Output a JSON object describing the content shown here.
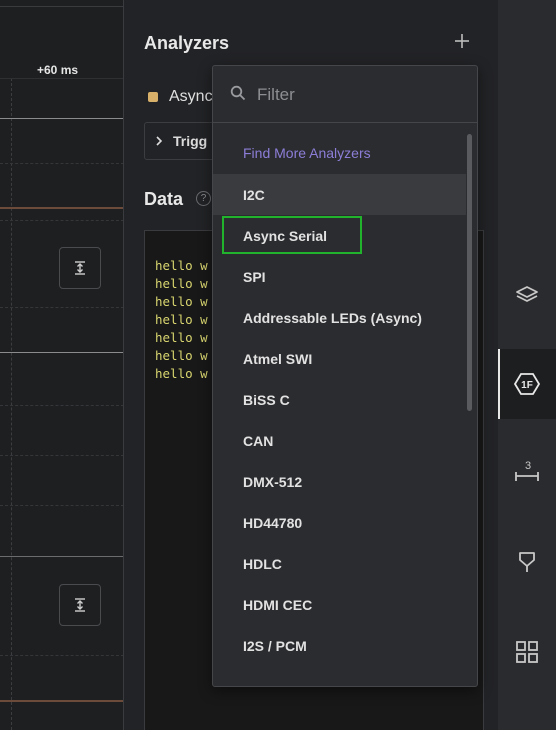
{
  "timeline": {
    "marker": "+60 ms"
  },
  "analyzers_panel": {
    "title": "Analyzers",
    "add_icon": "plus-icon",
    "analyzer_name": "Async",
    "analyzer_color": "#d8b06a",
    "trigger_label": "Trigg",
    "data_title": "Data",
    "help_glyph": "?",
    "terminal_lines": [
      "hello w",
      "hello w",
      "hello w",
      "hello w",
      "hello w",
      "hello w",
      "hello w"
    ]
  },
  "dropdown": {
    "filter_placeholder": "Filter",
    "find_more_label": "Find More Analyzers",
    "options": [
      "I2C",
      "Async Serial",
      "SPI",
      "Addressable LEDs (Async)",
      "Atmel SWI",
      "BiSS C",
      "CAN",
      "DMX-512",
      "HD44780",
      "HDLC",
      "HDMI CEC",
      "I2S / PCM"
    ],
    "hovered_option": "I2C",
    "highlighted_option": "Async Serial",
    "highlight_color": "#22b32c",
    "accent_color": "#8c7ed8"
  },
  "sidebar": {
    "items": [
      {
        "icon": "layers-icon",
        "active": false
      },
      {
        "icon": "analyzers-1f-icon",
        "label": "1F",
        "active": true
      },
      {
        "icon": "measurement-icon",
        "label": "3",
        "active": false
      },
      {
        "icon": "marker-flag-icon",
        "active": false
      },
      {
        "icon": "extensions-icon",
        "active": false
      }
    ]
  }
}
